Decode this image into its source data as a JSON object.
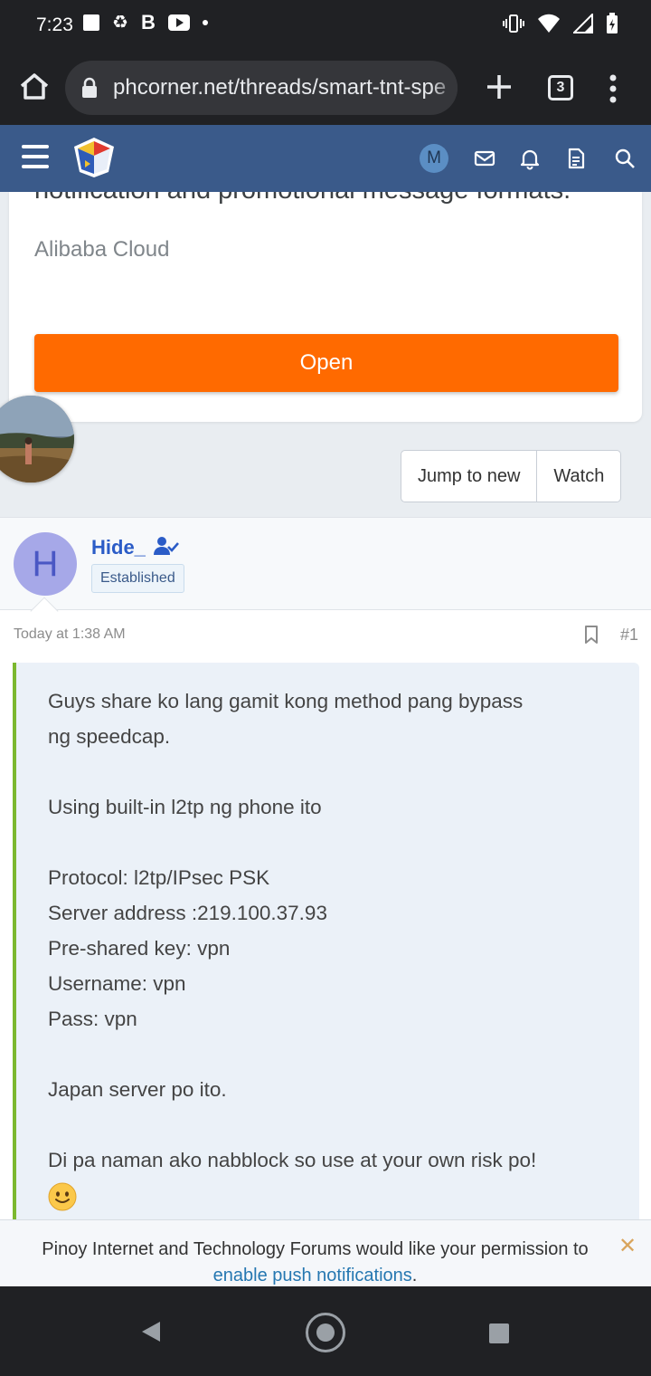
{
  "status_bar": {
    "time": "7:23",
    "icons": [
      "square-icon",
      "recycle-icon",
      "b-icon",
      "youtube-icon",
      "dot-icon",
      "vibrate-icon",
      "wifi-icon",
      "signal-icon",
      "battery-icon"
    ]
  },
  "browser": {
    "url": "phcorner.net/threads/smart-tnt-spe",
    "tab_count": "3"
  },
  "site_header": {
    "avatar_letter": "M",
    "icons": [
      "menu-icon",
      "logo-icon",
      "mail-icon",
      "bell-icon",
      "document-icon",
      "search-icon"
    ]
  },
  "ad": {
    "cut_text": "notification and promotional message formats.",
    "source": "Alibaba Cloud",
    "open_label": "Open",
    "button_color": "#ff6a00"
  },
  "thread_actions": {
    "jump_label": "Jump to new",
    "watch_label": "Watch"
  },
  "post": {
    "avatar_letter": "H",
    "username": "Hide_",
    "badge": "Established",
    "date": "Today at 1:38 AM",
    "number": "#1",
    "lines": [
      "Guys share ko lang gamit kong method pang bypass",
      "ng speedcap.",
      "Using built-in l2tp ng phone ito",
      "Protocol: l2tp/IPsec PSK",
      "Server address :219.100.37.93",
      "Pre-shared key: vpn",
      "Username: vpn",
      "Pass: vpn",
      "Japan server po ito.",
      "Di pa naman ako nabblock so use at your own risk po!"
    ]
  },
  "notification": {
    "text": "Pinoy Internet and Technology Forums would like your permission to",
    "link": "enable push notifications",
    "suffix": ".",
    "close": "✕"
  },
  "colors": {
    "header": "#3a5a8a",
    "accent_green": "#7cb82f",
    "link": "#2577b1",
    "username": "#2b5cc7"
  }
}
